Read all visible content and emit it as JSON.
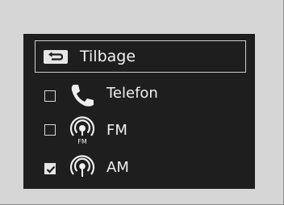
{
  "menu": {
    "back": {
      "label": "Tilbage",
      "icon": "back-arrow-icon"
    },
    "items": [
      {
        "label": "Telefon",
        "icon": "phone-icon",
        "checked": false
      },
      {
        "label": "FM",
        "icon": "fm-radio-icon",
        "icon_text": "FM",
        "checked": false
      },
      {
        "label": "AM",
        "icon": "am-radio-icon",
        "checked": true
      }
    ]
  },
  "colors": {
    "background": "#d6d6d6",
    "screen": "#1e1e1e",
    "text": "#f0f0f0",
    "outline": "#cfcfcf"
  }
}
